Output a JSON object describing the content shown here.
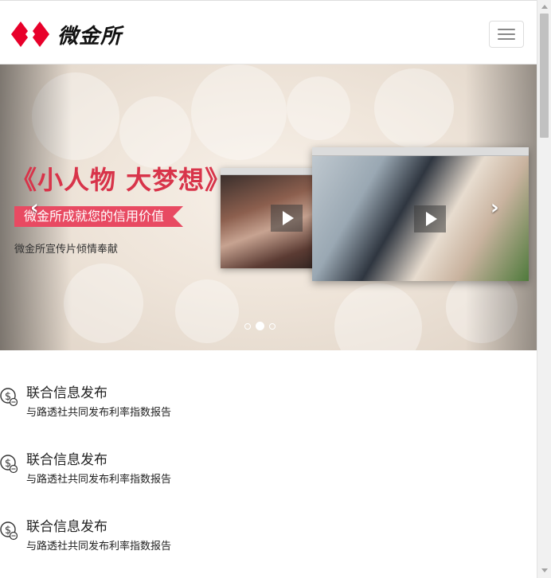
{
  "header": {
    "logo_text": "微金所",
    "logo_icon": "diamond-logo-icon",
    "menu_icon": "hamburger-icon"
  },
  "carousel": {
    "headline": "《小人物 大梦想》",
    "ribbon": "微金所成就您的信用价值",
    "subtitle": "微金所宣传片倾情奉献",
    "prev_icon": "chevron-left-icon",
    "next_icon": "chevron-right-icon",
    "slide_count": 3,
    "active_slide": 2
  },
  "news": {
    "items": [
      {
        "icon": "coin-icon",
        "title": "联合信息发布",
        "desc": "与路透社共同发布利率指数报告"
      },
      {
        "icon": "coin-icon",
        "title": "联合信息发布",
        "desc": "与路透社共同发布利率指数报告"
      },
      {
        "icon": "coin-icon",
        "title": "联合信息发布",
        "desc": "与路透社共同发布利率指数报告"
      }
    ]
  },
  "colors": {
    "brand_red": "#e8002a",
    "headline_red": "#d8344a",
    "ribbon_red": "#e84a62"
  }
}
